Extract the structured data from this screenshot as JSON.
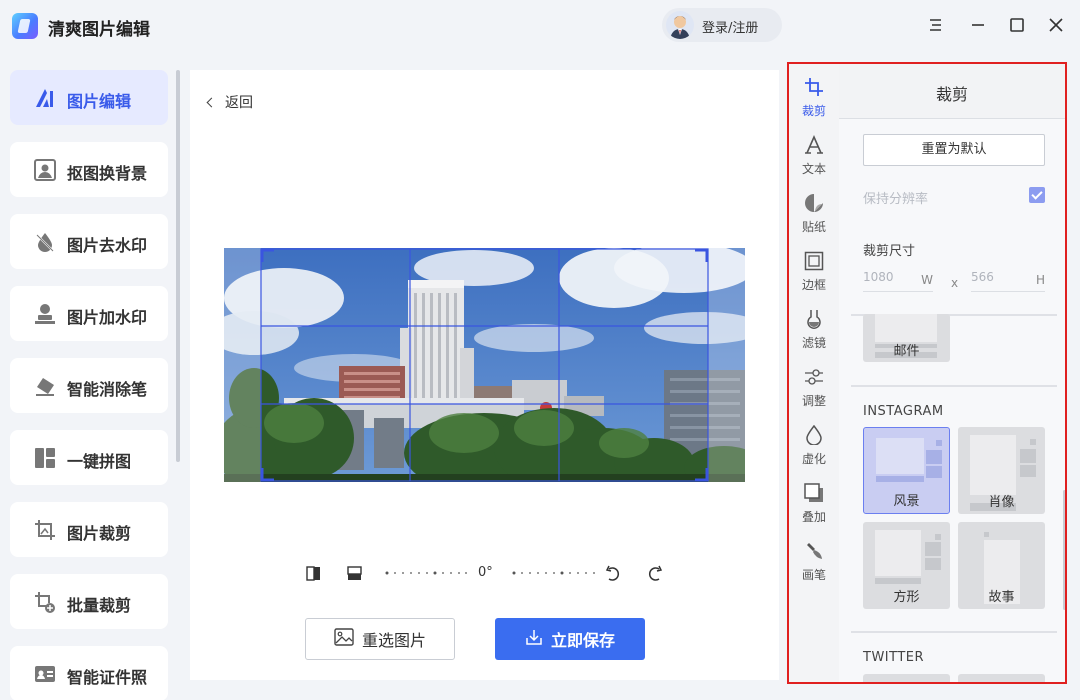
{
  "app": {
    "title": "清爽图片编辑",
    "login_label": "登录/注册"
  },
  "window_controls": {
    "menu": "menu-icon",
    "minimize": "minimize-icon",
    "maximize": "maximize-icon",
    "close": "close-icon"
  },
  "nav": {
    "items": [
      {
        "label": "图片编辑",
        "icon": "image-edit-icon",
        "active": true
      },
      {
        "label": "抠图换背景",
        "icon": "portrait-bg-icon",
        "active": false
      },
      {
        "label": "图片去水印",
        "icon": "watermark-remove-icon",
        "active": false
      },
      {
        "label": "图片加水印",
        "icon": "watermark-add-icon",
        "active": false
      },
      {
        "label": "智能消除笔",
        "icon": "eraser-icon",
        "active": false
      },
      {
        "label": "一键拼图",
        "icon": "collage-icon",
        "active": false
      },
      {
        "label": "图片裁剪",
        "icon": "crop-icon",
        "active": false
      },
      {
        "label": "批量裁剪",
        "icon": "batch-crop-icon",
        "active": false
      },
      {
        "label": "智能证件照",
        "icon": "id-photo-icon",
        "active": false
      }
    ]
  },
  "editor": {
    "back_label": "返回",
    "rotation_value": "0°",
    "reselect_label": "重选图片",
    "save_label": "立即保存"
  },
  "tools": {
    "items": [
      {
        "label": "裁剪",
        "icon": "crop-tool-icon",
        "active": true
      },
      {
        "label": "文本",
        "icon": "text-tool-icon",
        "active": false
      },
      {
        "label": "贴纸",
        "icon": "sticker-icon",
        "active": false
      },
      {
        "label": "边框",
        "icon": "frame-icon",
        "active": false
      },
      {
        "label": "滤镜",
        "icon": "filter-icon",
        "active": false
      },
      {
        "label": "调整",
        "icon": "adjust-icon",
        "active": false
      },
      {
        "label": "虚化",
        "icon": "blur-icon",
        "active": false
      },
      {
        "label": "叠加",
        "icon": "overlay-icon",
        "active": false
      },
      {
        "label": "画笔",
        "icon": "brush-icon",
        "active": false
      }
    ]
  },
  "crop_panel": {
    "title": "裁剪",
    "reset_label": "重置为默认",
    "keep_resolution_label": "保持分辨率",
    "keep_resolution_checked": true,
    "size_label": "裁剪尺寸",
    "width_value": "1080",
    "width_unit": "W",
    "times": "x",
    "height_value": "566",
    "height_unit": "H",
    "email_label": "邮件",
    "instagram_label": "INSTAGRAM",
    "instagram_presets": [
      {
        "label": "风景",
        "selected": true
      },
      {
        "label": "肖像",
        "selected": false
      },
      {
        "label": "方形",
        "selected": false
      },
      {
        "label": "故事",
        "selected": false
      }
    ],
    "twitter_label": "TWITTER"
  },
  "colors": {
    "accent": "#3a6df0",
    "active_nav_bg": "#e6eaff",
    "highlight_frame": "#e02020"
  }
}
